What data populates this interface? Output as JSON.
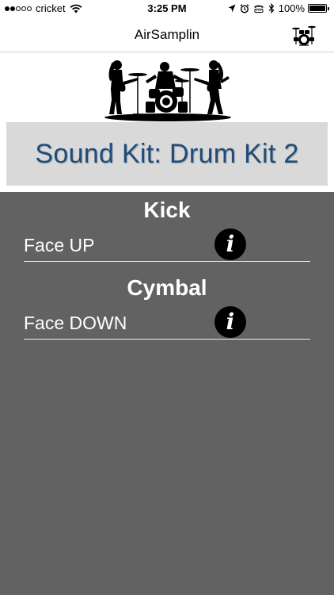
{
  "status_bar": {
    "carrier": "cricket",
    "time": "3:25 PM",
    "battery_percent": "100%",
    "signal_bars_filled": 2,
    "signal_bars_total": 5,
    "battery_level": 1.0,
    "icons": [
      "wifi-icon",
      "location-arrow-icon",
      "alarm-clock-icon",
      "tty-icon",
      "bluetooth-icon",
      "battery-icon"
    ]
  },
  "nav": {
    "title": "AirSamplin",
    "right_icon": "drum-kit-icon"
  },
  "banner": {
    "icon": "band-silhouette-image"
  },
  "kit": {
    "title": "Sound Kit: Drum Kit 2",
    "title_color": "#1e4d7b",
    "box_color": "#d9d9d9"
  },
  "panel_color": "#626262",
  "sections": [
    {
      "title": "Kick",
      "gesture": "Face UP",
      "info_icon": "info-icon"
    },
    {
      "title": "Cymbal",
      "gesture": "Face DOWN",
      "info_icon": "info-icon"
    }
  ]
}
